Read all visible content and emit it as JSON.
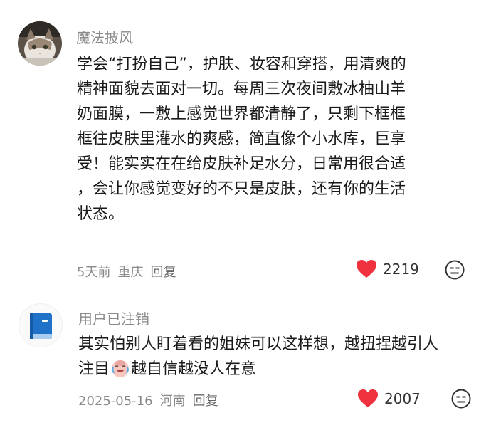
{
  "comments": [
    {
      "username": "魔法披风",
      "avatar_icon": "cat-photo-avatar",
      "lines": [
        "学会“打扮自己”，护肤、妆容和穿搭，用清爽的",
        "精神面貌去面对一切。每周三次夜间敷冰柚山羊",
        "奶面膜，一敷上感觉世界都清静了，只剩下框框",
        "框往皮肤里灌水的爽感，简直像个小水库，巨享",
        "受！能实实在在给皮肤补足水分，日常用很合适",
        "，会让你感觉变好的不只是皮肤，还有你的生活",
        "状态。"
      ],
      "time": "5天前",
      "location": "重庆",
      "reply_label": "回复",
      "likes": "2219"
    },
    {
      "username": "用户已注销",
      "avatar_icon": "blue-book-avatar",
      "line1": "其实怕别人盯着看的姐妹可以这样想，越扭捏越引人",
      "line2_before": "注目",
      "line2_emoji": "crying-laughing-emoji",
      "line2_after": "越自信越没人在意",
      "time": "2025-05-16",
      "location": "河南",
      "reply_label": "回复",
      "likes": "2007"
    }
  ],
  "colors": {
    "heart": "#f0323f",
    "meta": "#8a8a8a",
    "username": "#8a8a8a"
  }
}
